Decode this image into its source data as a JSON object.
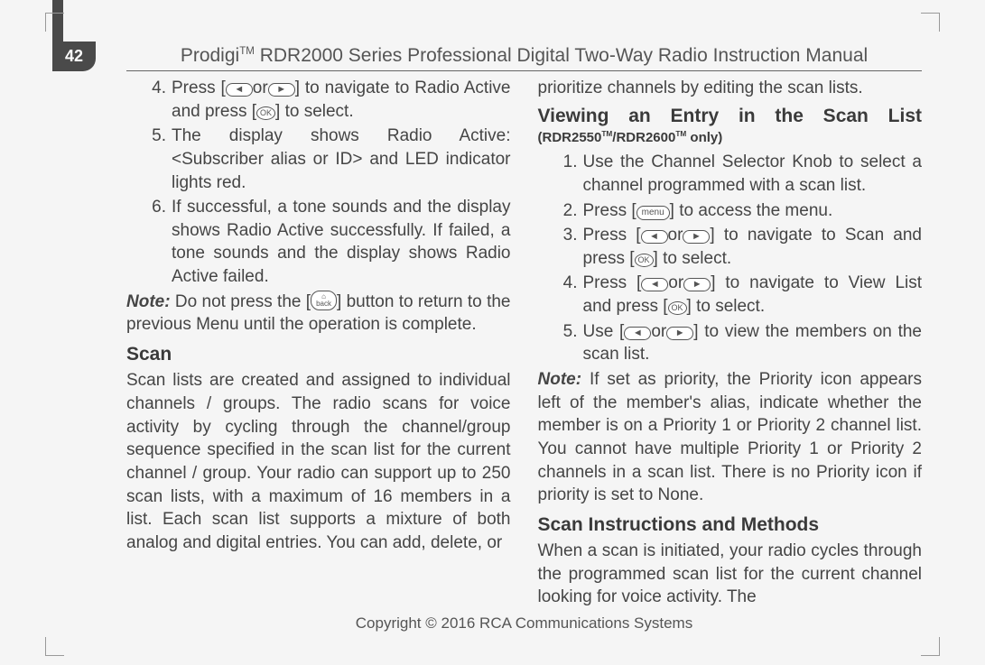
{
  "page_number": "42",
  "header": {
    "brand": "Prodigi",
    "series": " RDR2000 Series Professional Digital Two-Way Radio Instruction Manual"
  },
  "icons": {
    "left_arrow": "◄",
    "right_arrow": "►",
    "ok": "OK",
    "menu": "menu",
    "back_top": "⌂",
    "back_text": "back"
  },
  "left_col": {
    "item4_a": "Press [",
    "item4_b": "or",
    "item4_c": "] to navigate to Radio Active and press [",
    "item4_d": "] to select.",
    "item5": "The display shows Radio Active: <Subscriber alias or ID> and LED indicator lights red.",
    "item6": "If successful, a tone sounds and the display shows Radio Active successfully. If failed, a tone sounds and the display shows Radio Active failed.",
    "note_label": "Note:",
    "note_a": " Do not press the [",
    "note_b": "] button to return to the previous Menu until the operation is complete.",
    "scan_heading": "Scan",
    "scan_para": "Scan lists are created and assigned to individual channels / groups. The radio scans for voice activity by cycling through the channel/group sequence specified in the scan list for the current channel / group. Your radio can support up to 250 scan lists, with a maximum of 16 members in a list. Each scan list supports a mixture of both analog and digital entries. You can add, delete, or"
  },
  "right_col": {
    "cont": "prioritize channels by editing the scan lists.",
    "view_heading": "Viewing an Entry in the Scan List",
    "view_sub_a": "(RDR2550",
    "view_sub_b": "/RDR2600",
    "view_sub_c": " only)",
    "v1": "Use the Channel Selector Knob to select a channel programmed with a scan list.",
    "v2_a": "Press [",
    "v2_b": "] to access the menu.",
    "v3_a": "Press [",
    "v3_b": "or",
    "v3_c": "] to navigate to Scan and press [",
    "v3_d": "] to select.",
    "v4_a": "Press [",
    "v4_b": "or",
    "v4_c": "] to navigate to View List and press [",
    "v4_d": "] to select.",
    "v5_a": "Use [",
    "v5_b": "or",
    "v5_c": "] to view the members on the scan list.",
    "note2_label": "Note:",
    "note2_text": " If set as priority, the Priority icon appears left of the member's alias, indicate whether the member is on a Priority 1 or Priority 2 channel list. You cannot have multiple Priority 1 or Priority 2 channels in a scan list. There is no Priority icon if priority is set to None.",
    "scan_instr_heading": "Scan Instructions and Methods",
    "scan_instr_para": "When a scan is initiated, your radio cycles through the programmed scan list for the current channel looking for voice activity. The"
  },
  "footer": "Copyright © 2016 RCA Communications Systems"
}
